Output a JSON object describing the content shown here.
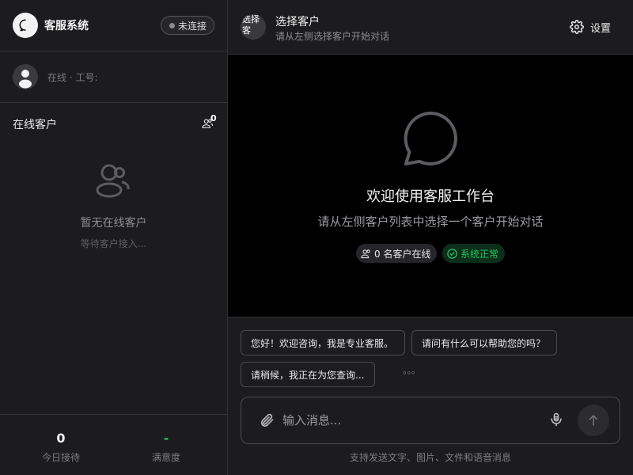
{
  "sidebar": {
    "brand_title": "客服系统",
    "connection_status": "未连接",
    "agent_status": "在线 · 工号:",
    "online_section_title": "在线客户",
    "online_count": "0",
    "empty_title": "暂无在线客户",
    "empty_subtitle": "等待客户接入...",
    "stats": [
      {
        "value": "0",
        "label": "今日接待",
        "color": "#f2f2f2"
      },
      {
        "value": "-",
        "label": "满意度",
        "color": "#22c55e"
      }
    ]
  },
  "header": {
    "avatar_alt": "选择客",
    "title": "选择客户",
    "subtitle": "请从左侧选择客户开始对话",
    "settings_label": "设置"
  },
  "welcome": {
    "title": "欢迎使用客服工作台",
    "subtitle": "请从左侧客户列表中选择一个客户开始对话",
    "online_chip": "0 名客户在线",
    "status_chip": "系统正常"
  },
  "quick_replies": [
    "您好！欢迎咨询，我是专业客服。",
    "请问有什么可以帮助您的吗？",
    "请稍候，我正在为您查询..."
  ],
  "more_dots": "◦◦◦",
  "composer": {
    "placeholder": "输入消息...",
    "hint": "支持发送文字、图片、文件和语音消息"
  },
  "colors": {
    "accent_green": "#22c55e",
    "panel": "#1c1c1e",
    "background": "#000000"
  }
}
